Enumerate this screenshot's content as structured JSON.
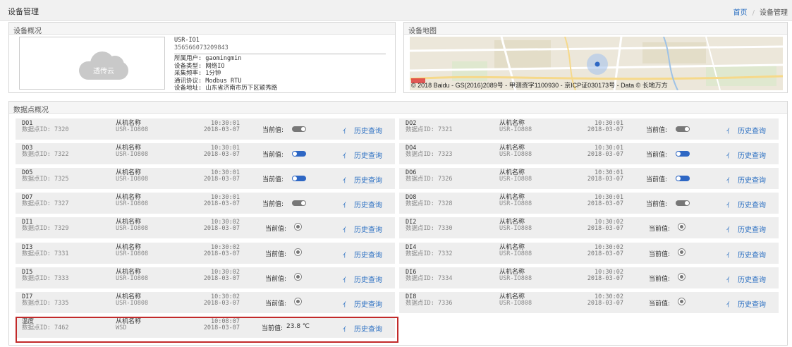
{
  "page": {
    "title": "设备管理",
    "breadcrumb": {
      "home": "首页",
      "current": "设备管理"
    }
  },
  "overview": {
    "heading": "设备概况",
    "image_label": "透传云",
    "device_name": "USR-IO1",
    "serial": "356566073209843",
    "owner": "所属用户: gaomingmin",
    "type": "设备类型: 网络IO",
    "frequency": "采集频率: 1分钟",
    "protocol": "通讯协议: Modbus RTU",
    "address": "设备地址: 山东省济南市历下区颖秀路"
  },
  "map": {
    "heading": "设备地图",
    "copyright": "© 2018 Baidu - GS(2016)2089号 - 甲测资字1100930 - 京ICP证030173号 - Data © 长地万方"
  },
  "datapoints": {
    "heading": "数据点概况",
    "current_label": "当前值:",
    "history_label": "历史查询",
    "rows": [
      {
        "name": "DO1",
        "id": "数据点ID: 7320",
        "slave": "从机名称",
        "slave_sub": "USR-IO808",
        "time": "10:30:01",
        "date": "2018-03-07",
        "kind": "toggle",
        "state": "off"
      },
      {
        "name": "DO2",
        "id": "数据点ID: 7321",
        "slave": "从机名称",
        "slave_sub": "USR-IO808",
        "time": "10:30:01",
        "date": "2018-03-07",
        "kind": "toggle",
        "state": "off"
      },
      {
        "name": "DO3",
        "id": "数据点ID: 7322",
        "slave": "从机名称",
        "slave_sub": "USR-IO808",
        "time": "10:30:01",
        "date": "2018-03-07",
        "kind": "toggle",
        "state": "on"
      },
      {
        "name": "DO4",
        "id": "数据点ID: 7323",
        "slave": "从机名称",
        "slave_sub": "USR-IO808",
        "time": "10:30:01",
        "date": "2018-03-07",
        "kind": "toggle",
        "state": "on"
      },
      {
        "name": "DO5",
        "id": "数据点ID: 7325",
        "slave": "从机名称",
        "slave_sub": "USR-IO808",
        "time": "10:30:01",
        "date": "2018-03-07",
        "kind": "toggle",
        "state": "on"
      },
      {
        "name": "DO6",
        "id": "数据点ID: 7326",
        "slave": "从机名称",
        "slave_sub": "USR-IO808",
        "time": "10:30:01",
        "date": "2018-03-07",
        "kind": "toggle",
        "state": "on"
      },
      {
        "name": "DO7",
        "id": "数据点ID: 7327",
        "slave": "从机名称",
        "slave_sub": "USR-IO808",
        "time": "10:30:01",
        "date": "2018-03-07",
        "kind": "toggle",
        "state": "off"
      },
      {
        "name": "DO8",
        "id": "数据点ID: 7328",
        "slave": "从机名称",
        "slave_sub": "USR-IO808",
        "time": "10:30:01",
        "date": "2018-03-07",
        "kind": "toggle",
        "state": "off"
      },
      {
        "name": "DI1",
        "id": "数据点ID: 7329",
        "slave": "从机名称",
        "slave_sub": "USR-IO808",
        "time": "10:30:02",
        "date": "2018-03-07",
        "kind": "radio"
      },
      {
        "name": "DI2",
        "id": "数据点ID: 7330",
        "slave": "从机名称",
        "slave_sub": "USR-IO808",
        "time": "10:30:02",
        "date": "2018-03-07",
        "kind": "radio"
      },
      {
        "name": "DI3",
        "id": "数据点ID: 7331",
        "slave": "从机名称",
        "slave_sub": "USR-IO808",
        "time": "10:30:02",
        "date": "2018-03-07",
        "kind": "radio"
      },
      {
        "name": "DI4",
        "id": "数据点ID: 7332",
        "slave": "从机名称",
        "slave_sub": "USR-IO808",
        "time": "10:30:02",
        "date": "2018-03-07",
        "kind": "radio"
      },
      {
        "name": "DI5",
        "id": "数据点ID: 7333",
        "slave": "从机名称",
        "slave_sub": "USR-IO808",
        "time": "10:30:02",
        "date": "2018-03-07",
        "kind": "radio"
      },
      {
        "name": "DI6",
        "id": "数据点ID: 7334",
        "slave": "从机名称",
        "slave_sub": "USR-IO808",
        "time": "10:30:02",
        "date": "2018-03-07",
        "kind": "radio"
      },
      {
        "name": "DI7",
        "id": "数据点ID: 7335",
        "slave": "从机名称",
        "slave_sub": "USR-IO808",
        "time": "10:30:02",
        "date": "2018-03-07",
        "kind": "radio"
      },
      {
        "name": "DI8",
        "id": "数据点ID: 7336",
        "slave": "从机名称",
        "slave_sub": "USR-IO808",
        "time": "10:30:02",
        "date": "2018-03-07",
        "kind": "radio"
      },
      {
        "name": "温度",
        "id": "数据点ID: 7462",
        "slave": "从机名称",
        "slave_sub": "WSD",
        "time": "10:08:07",
        "date": "2018-03-07",
        "kind": "value",
        "value": "23.8 ℃"
      }
    ]
  },
  "colors": {
    "accent": "#2a6fc2",
    "toggle_on": "#2e67c4",
    "toggle_off": "#777777",
    "highlight": "#c22a2a"
  },
  "icons": {
    "history": "trend-line-icon",
    "device": "cloud-icon"
  }
}
